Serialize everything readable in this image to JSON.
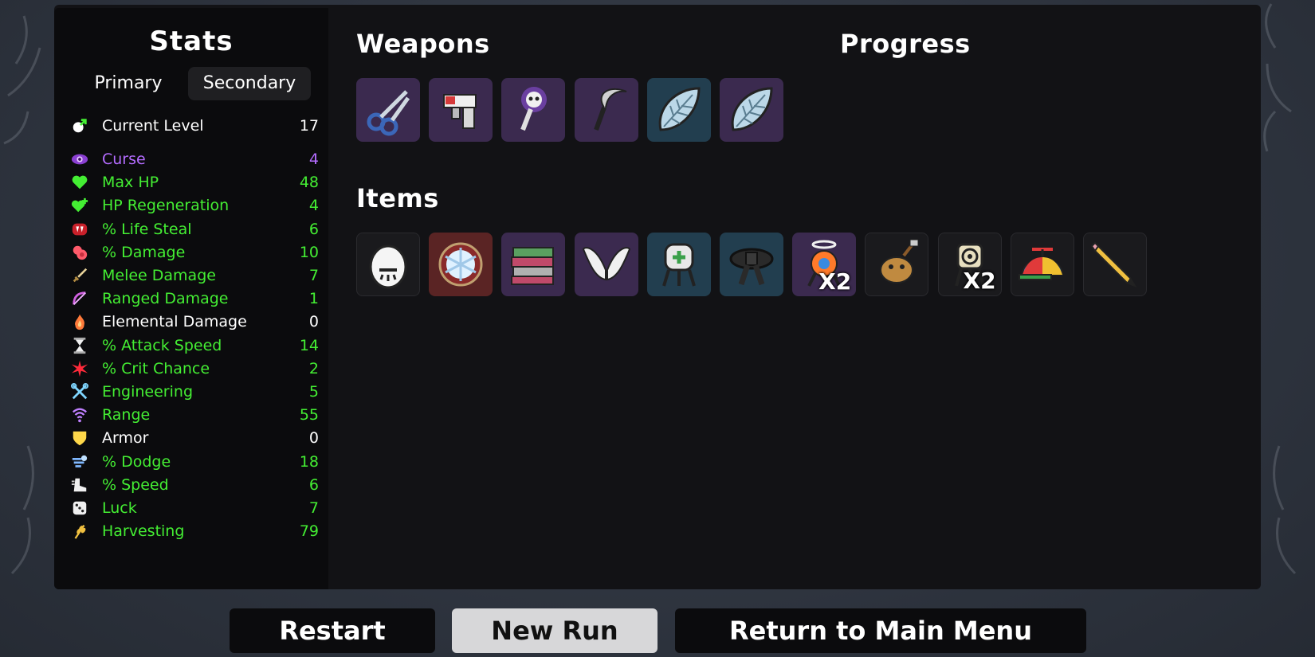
{
  "stats": {
    "title": "Stats",
    "tabs": {
      "primary": "Primary",
      "secondary": "Secondary"
    },
    "current_level": {
      "label": "Current Level",
      "value": "17"
    },
    "rows": [
      {
        "label": "Curse",
        "value": "4",
        "color": "#b46cff",
        "icon": "curse-eye-icon"
      },
      {
        "label": "Max HP",
        "value": "48",
        "color": "#44ee33",
        "icon": "heart-icon"
      },
      {
        "label": "HP Regeneration",
        "value": "4",
        "color": "#44ee33",
        "icon": "heart-plus-icon"
      },
      {
        "label": "% Life Steal",
        "value": "6",
        "color": "#44ee33",
        "icon": "fangs-icon"
      },
      {
        "label": "% Damage",
        "value": "10",
        "color": "#44ee33",
        "icon": "muscle-icon"
      },
      {
        "label": "Melee Damage",
        "value": "7",
        "color": "#44ee33",
        "icon": "sword-icon"
      },
      {
        "label": "Ranged Damage",
        "value": "1",
        "color": "#44ee33",
        "icon": "bow-icon"
      },
      {
        "label": "Elemental Damage",
        "value": "0",
        "color": "#ffffff",
        "icon": "flame-icon"
      },
      {
        "label": "% Attack Speed",
        "value": "14",
        "color": "#44ee33",
        "icon": "hourglass-icon"
      },
      {
        "label": "% Crit Chance",
        "value": "2",
        "color": "#44ee33",
        "icon": "crit-star-icon"
      },
      {
        "label": "Engineering",
        "value": "5",
        "color": "#44ee33",
        "icon": "wrench-icon"
      },
      {
        "label": "Range",
        "value": "55",
        "color": "#44ee33",
        "icon": "range-waves-icon"
      },
      {
        "label": "Armor",
        "value": "0",
        "color": "#ffffff",
        "icon": "shield-icon"
      },
      {
        "label": "% Dodge",
        "value": "18",
        "color": "#44ee33",
        "icon": "dash-icon"
      },
      {
        "label": "% Speed",
        "value": "6",
        "color": "#44ee33",
        "icon": "boot-icon"
      },
      {
        "label": "Luck",
        "value": "7",
        "color": "#44ee33",
        "icon": "dice-icon"
      },
      {
        "label": "Harvesting",
        "value": "79",
        "color": "#44ee33",
        "icon": "wheat-icon"
      }
    ]
  },
  "weapons": {
    "title": "Weapons",
    "slots": [
      {
        "icon": "scissors-icon",
        "tier": "purple"
      },
      {
        "icon": "nail-gun-icon",
        "tier": "purple"
      },
      {
        "icon": "skull-wand-icon",
        "tier": "purple"
      },
      {
        "icon": "sickle-icon",
        "tier": "purple"
      },
      {
        "icon": "leaf-blade-icon",
        "tier": "blue"
      },
      {
        "icon": "leaf-blade-icon",
        "tier": "purple"
      }
    ]
  },
  "progress": {
    "title": "Progress"
  },
  "items": {
    "title": "Items",
    "slots": [
      {
        "icon": "egg-face-icon",
        "tier": "dark",
        "count": ""
      },
      {
        "icon": "snowflake-orb-icon",
        "tier": "red",
        "count": ""
      },
      {
        "icon": "books-icon",
        "tier": "purple",
        "count": ""
      },
      {
        "icon": "wings-icon",
        "tier": "purple",
        "count": ""
      },
      {
        "icon": "medic-turret-icon",
        "tier": "blue",
        "count": ""
      },
      {
        "icon": "black-belt-icon",
        "tier": "blue",
        "count": ""
      },
      {
        "icon": "halo-turret-icon",
        "tier": "purple",
        "count": "X2"
      },
      {
        "icon": "lumberjack-critter-icon",
        "tier": "dark",
        "count": ""
      },
      {
        "icon": "target-turret-icon",
        "tier": "dark",
        "count": "X2"
      },
      {
        "icon": "propeller-hat-icon",
        "tier": "dark",
        "count": ""
      },
      {
        "icon": "pencil-icon",
        "tier": "dark",
        "count": ""
      }
    ]
  },
  "buttons": {
    "restart": "Restart",
    "new_run": "New Run",
    "main_menu": "Return to Main Menu"
  }
}
